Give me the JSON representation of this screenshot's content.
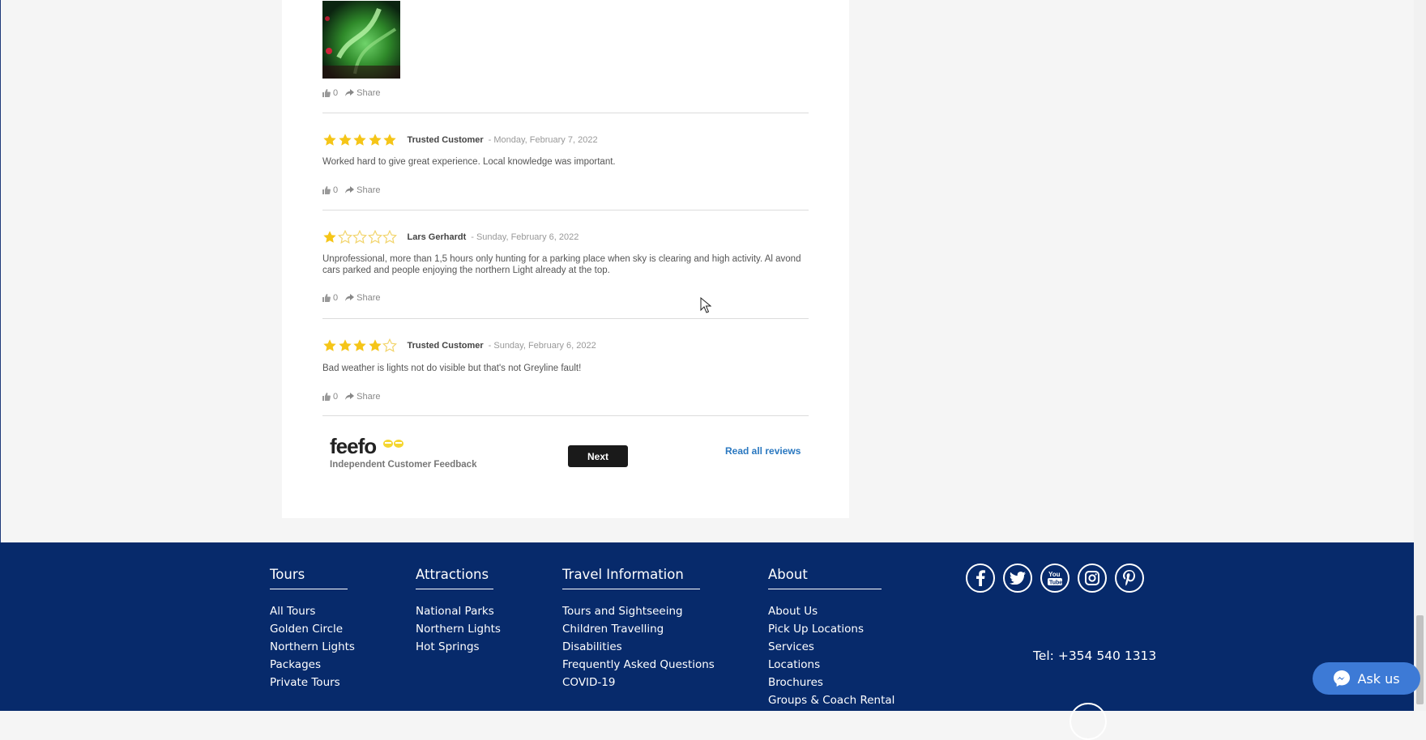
{
  "reviews": [
    {
      "rating": 5,
      "name": "Trusted Customer",
      "date": "- Monday, February 7, 2022",
      "text": "Worked hard to give great experience. Local knowledge was important.",
      "likes": "0",
      "share": "Share"
    },
    {
      "rating": 1,
      "name": "Lars Gerhardt",
      "date": "- Sunday, February 6, 2022",
      "text": "Unprofessional, more than 1,5 hours only hunting for a parking place when sky is clearing and high activity. Al avond cars parked and people enjoying the northern Light already at the top.",
      "likes": "0",
      "share": "Share"
    },
    {
      "rating": 4,
      "name": "Trusted Customer",
      "date": "- Sunday, February 6, 2022",
      "text": "Bad weather is lights not do visible but that's not Greyline fault!",
      "likes": "0",
      "share": "Share"
    }
  ],
  "first_actions": {
    "likes": "0",
    "share": "Share"
  },
  "feefo": {
    "logo_text": "feefo",
    "tagline": "Independent Customer Feedback",
    "next_label": "Next",
    "read_all": "Read all reviews"
  },
  "footer": {
    "tours": {
      "heading": "Tours",
      "links": [
        "All Tours",
        "Golden Circle",
        "Northern Lights",
        "Packages",
        "Private Tours"
      ]
    },
    "attractions": {
      "heading": "Attractions",
      "links": [
        "National Parks",
        "Northern Lights",
        "Hot Springs"
      ]
    },
    "travel": {
      "heading": "Travel Information",
      "links": [
        "Tours and Sightseeing",
        "Children Travelling",
        "Disabilities",
        "Frequently Asked Questions",
        "COVID-19"
      ]
    },
    "about": {
      "heading": "About",
      "links": [
        "About Us",
        "Pick Up Locations",
        "Services",
        "Locations",
        "Brochures",
        "Groups & Coach Rental"
      ]
    },
    "social": [
      "facebook-icon",
      "twitter-icon",
      "youtube-icon",
      "instagram-icon",
      "pinterest-icon"
    ],
    "tel": "Tel: +354 540 1313"
  },
  "chat": {
    "label": "Ask us"
  },
  "colors": {
    "footer_bg": "#072a6b",
    "star": "#f5c518",
    "star_empty": "#f2d46b",
    "link": "#2a78c0",
    "chat": "#3d7ad6"
  }
}
